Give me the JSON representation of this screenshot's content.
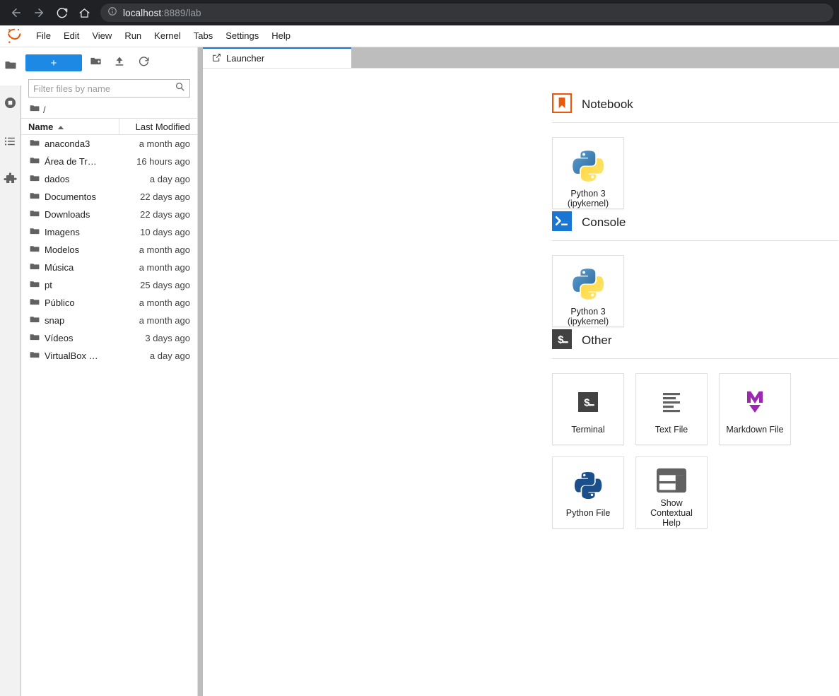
{
  "browser": {
    "back_icon": "arrow-left-icon",
    "forward_icon": "arrow-right-icon",
    "reload_icon": "reload-icon",
    "home_icon": "home-icon",
    "info_icon": "info-icon",
    "url_host": "localhost",
    "url_rest": ":8889/lab"
  },
  "menubar": {
    "logo": "jupyter-logo",
    "items": [
      {
        "label": "File"
      },
      {
        "label": "Edit"
      },
      {
        "label": "View"
      },
      {
        "label": "Run"
      },
      {
        "label": "Kernel"
      },
      {
        "label": "Tabs"
      },
      {
        "label": "Settings"
      },
      {
        "label": "Help"
      }
    ]
  },
  "activity_bar": {
    "items": [
      {
        "name": "file-browser",
        "icon": "folder-icon",
        "active": true
      },
      {
        "name": "running-terminals-kernels",
        "icon": "stop-circle-icon",
        "active": false
      },
      {
        "name": "commands",
        "icon": "list-icon",
        "active": false
      },
      {
        "name": "extension-manager",
        "icon": "puzzle-icon",
        "active": false
      }
    ]
  },
  "file_browser": {
    "new_launcher_label": "+",
    "new_folder_icon": "new-folder-icon",
    "upload_icon": "upload-icon",
    "refresh_icon": "refresh-icon",
    "filter": {
      "placeholder": "Filter files by name",
      "value": "",
      "search_icon": "search-icon"
    },
    "breadcrumb": {
      "icon": "folder-icon",
      "path": "/"
    },
    "columns": {
      "name": "Name",
      "last_modified": "Last Modified",
      "sort_icon": "caret-up-icon"
    },
    "rows": [
      {
        "name": "anaconda3",
        "modified": "a month ago",
        "icon": "folder-icon"
      },
      {
        "name": "Área de Tr…",
        "modified": "16 hours ago",
        "icon": "folder-icon"
      },
      {
        "name": "dados",
        "modified": "a day ago",
        "icon": "folder-icon"
      },
      {
        "name": "Documentos",
        "modified": "22 days ago",
        "icon": "folder-icon"
      },
      {
        "name": "Downloads",
        "modified": "22 days ago",
        "icon": "folder-icon"
      },
      {
        "name": "Imagens",
        "modified": "10 days ago",
        "icon": "folder-icon"
      },
      {
        "name": "Modelos",
        "modified": "a month ago",
        "icon": "folder-icon"
      },
      {
        "name": "Música",
        "modified": "a month ago",
        "icon": "folder-icon"
      },
      {
        "name": "pt",
        "modified": "25 days ago",
        "icon": "folder-icon"
      },
      {
        "name": "Público",
        "modified": "a month ago",
        "icon": "folder-icon"
      },
      {
        "name": "snap",
        "modified": "a month ago",
        "icon": "folder-icon"
      },
      {
        "name": "Vídeos",
        "modified": "3 days ago",
        "icon": "folder-icon"
      },
      {
        "name": "VirtualBox …",
        "modified": "a day ago",
        "icon": "folder-icon"
      }
    ]
  },
  "tabs": [
    {
      "label": "Launcher",
      "icon": "launcher-icon",
      "active": true
    }
  ],
  "launcher": {
    "sections": [
      {
        "title": "Notebook",
        "icon": "notebook-icon",
        "cards": [
          {
            "label": "Python 3\n(ipykernel)",
            "line1": "Python 3",
            "line2": "(ipykernel)",
            "icon": "python-logo-icon"
          }
        ]
      },
      {
        "title": "Console",
        "icon": "console-icon",
        "cards": [
          {
            "label": "Python 3\n(ipykernel)",
            "line1": "Python 3",
            "line2": "(ipykernel)",
            "icon": "python-logo-icon"
          }
        ]
      },
      {
        "title": "Other",
        "icon": "terminal-dollar-icon",
        "cards": [
          {
            "line1": "Terminal",
            "line2": "",
            "icon": "terminal-dollar-icon"
          },
          {
            "line1": "Text File",
            "line2": "",
            "icon": "text-file-icon"
          },
          {
            "line1": "Markdown File",
            "line2": "",
            "icon": "markdown-icon"
          },
          {
            "line1": "Python File",
            "line2": "",
            "icon": "python-file-icon"
          },
          {
            "line1": "Show Contextual",
            "line2": "Help",
            "icon": "contextual-help-icon"
          }
        ]
      }
    ]
  },
  "colors": {
    "accent_blue": "#1e88e5",
    "tab_active_border": "#1976d2",
    "notebook_orange": "#e8590c",
    "console_blue": "#1976d2",
    "terminal_gray": "#424242",
    "markdown_purple": "#9c27b0",
    "python_blue": "#306998",
    "python_yellow": "#ffd43b",
    "chrome_dark": "#202124",
    "splitter_gray": "#bdbdbd"
  }
}
